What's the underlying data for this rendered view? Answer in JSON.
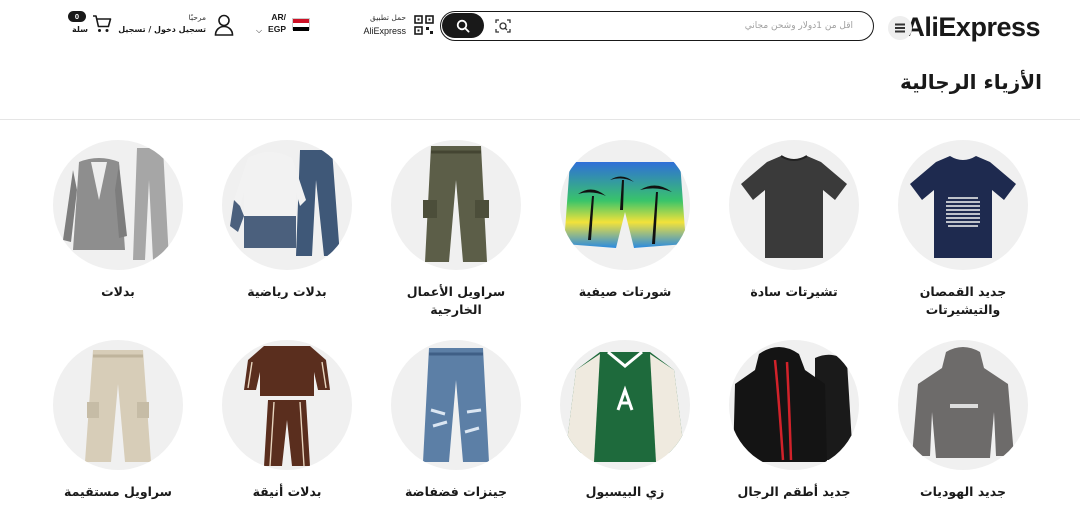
{
  "header": {
    "logo": "AliExpress",
    "search": {
      "placeholder": "أقل من 1دولار وشحن مجاني"
    },
    "app_download": {
      "line1": "حمل تطبيق",
      "line2": "AliExpress"
    },
    "language": {
      "lang": "AR/",
      "currency": "EGP"
    },
    "account": {
      "greeting": "مرحبًا",
      "action": "تسجيل دخول / تسجيل"
    },
    "cart": {
      "count": "0",
      "label": "سلة"
    }
  },
  "page_title": "الأزياء الرجالية",
  "categories": [
    {
      "label": "جديد القمصان والتيشيرتات",
      "icon": "tshirt-navy"
    },
    {
      "label": "تشيرتات سادة",
      "icon": "tshirt-charcoal"
    },
    {
      "label": "شورتات صيفية",
      "icon": "shorts-palm"
    },
    {
      "label": "سراويل الأعمال الخارجية",
      "icon": "cargo-pants"
    },
    {
      "label": "بدلات رياضية",
      "icon": "tracksuit"
    },
    {
      "label": "بدلات",
      "icon": "suit"
    },
    {
      "label": "جديد الهوديات",
      "icon": "hoodie-grey"
    },
    {
      "label": "جديد أطقم الرجال",
      "icon": "hoodie-set-black"
    },
    {
      "label": "زي البيسبول",
      "icon": "baseball-jacket"
    },
    {
      "label": "جينزات فضفاضة",
      "icon": "jeans"
    },
    {
      "label": "بدلات أنيقة",
      "icon": "track-set-brown"
    },
    {
      "label": "سراويل مستقيمة",
      "icon": "straight-pants"
    }
  ],
  "colors": {
    "accent": "#191919",
    "logo_star": "#ffcc00",
    "circle_bg": "#f0f0f0"
  }
}
